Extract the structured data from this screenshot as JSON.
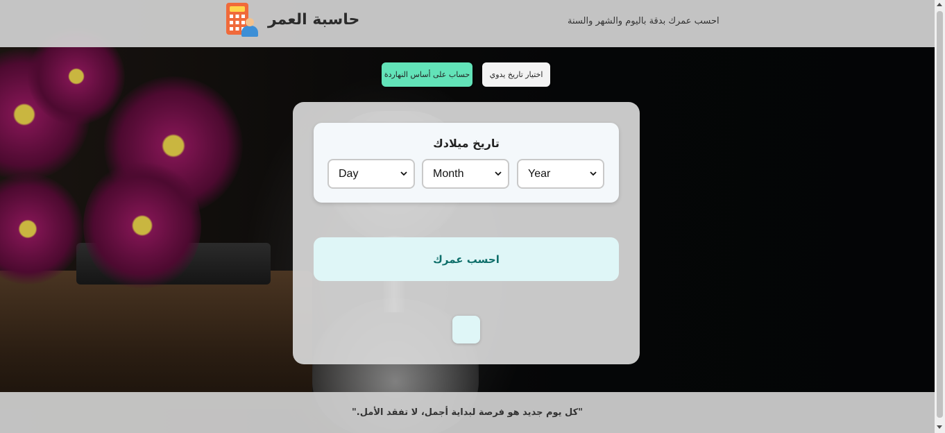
{
  "header": {
    "title": "حاسبة العمر",
    "tagline": "احسب عمرك بدقة باليوم والشهر والسنة",
    "logo_icon": "calculator-person-icon"
  },
  "modes": {
    "hijri_label": "حساب على أساس النهاردة",
    "manual_label": "اختيار تاريخ يدوي",
    "active_color": "#62e3b8"
  },
  "form": {
    "birth_title": "تاريخ ميلادك",
    "day_value": "Day",
    "month_value": "Month",
    "year_value": "Year",
    "calculate_label": "احسب عمرك",
    "calculate_color": "#0f6f6b"
  },
  "footer": {
    "quote": "\"كل يوم جديد هو فرصة لبداية أجمل، لا تفقد الأمل.\""
  }
}
